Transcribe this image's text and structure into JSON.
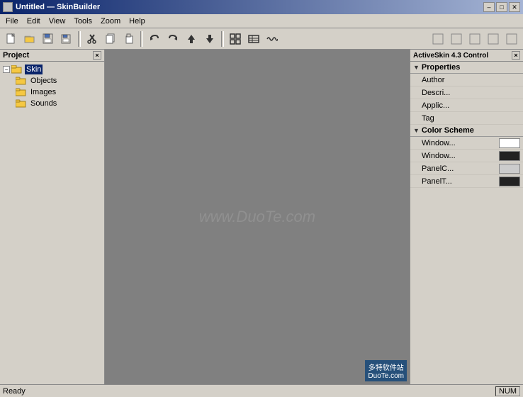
{
  "titlebar": {
    "title": "Untitled — SkinBuilder",
    "minimize_label": "–",
    "maximize_label": "□",
    "close_label": "✕"
  },
  "menubar": {
    "items": [
      "File",
      "Edit",
      "View",
      "Tools",
      "Zoom",
      "Help"
    ]
  },
  "toolbar": {
    "buttons": [
      {
        "name": "new-btn",
        "icon": "📄",
        "label": "New"
      },
      {
        "name": "open-btn",
        "icon": "📂",
        "label": "Open"
      },
      {
        "name": "save-btn",
        "icon": "💾",
        "label": "Save"
      },
      {
        "name": "save-all-btn",
        "icon": "🗂",
        "label": "Save All"
      },
      {
        "name": "cut-btn",
        "icon": "✂",
        "label": "Cut"
      },
      {
        "name": "copy-btn",
        "icon": "📋",
        "label": "Copy"
      },
      {
        "name": "paste-btn",
        "icon": "📌",
        "label": "Paste"
      },
      {
        "name": "undo-btn",
        "icon": "↩",
        "label": "Undo"
      },
      {
        "name": "redo-btn",
        "icon": "↪",
        "label": "Redo"
      },
      {
        "name": "up-btn",
        "icon": "↑",
        "label": "Up"
      },
      {
        "name": "down-btn",
        "icon": "↓",
        "label": "Down"
      },
      {
        "name": "grid-btn",
        "icon": "⊞",
        "label": "Grid"
      },
      {
        "name": "table-btn",
        "icon": "⊟",
        "label": "Table"
      },
      {
        "name": "wave-btn",
        "icon": "≋",
        "label": "Wave"
      }
    ]
  },
  "project_panel": {
    "title": "Project",
    "close_label": "×",
    "tree": {
      "root": {
        "label": "Skin",
        "expanded": true,
        "children": [
          {
            "label": "Objects",
            "type": "folder"
          },
          {
            "label": "Images",
            "type": "folder"
          },
          {
            "label": "Sounds",
            "type": "folder"
          }
        ]
      }
    }
  },
  "canvas": {
    "watermark": "www.DuoTe.com",
    "logo_line1": "多特软件站",
    "logo_line2": "DuoTe.com"
  },
  "properties_panel": {
    "title": "ActiveSkin 4.3 Control",
    "close_label": "×",
    "sections": [
      {
        "name": "Properties",
        "expanded": true,
        "rows": [
          {
            "label": "Author",
            "value": "",
            "has_swatch": false
          },
          {
            "label": "Descri...",
            "value": "",
            "has_swatch": false
          },
          {
            "label": "Applic...",
            "value": "",
            "has_swatch": false
          },
          {
            "label": "Tag",
            "value": "",
            "has_swatch": false
          }
        ]
      },
      {
        "name": "Color Scheme",
        "expanded": true,
        "rows": [
          {
            "label": "Window...",
            "value": "",
            "has_swatch": true,
            "dark": false
          },
          {
            "label": "Window...",
            "value": "",
            "has_swatch": true,
            "dark": true
          },
          {
            "label": "PanelC...",
            "value": "",
            "has_swatch": true,
            "dark": false
          },
          {
            "label": "PanelT...",
            "value": "",
            "has_swatch": true,
            "dark": true
          }
        ]
      }
    ]
  },
  "statusbar": {
    "status": "Ready",
    "num_lock": "NUM"
  }
}
